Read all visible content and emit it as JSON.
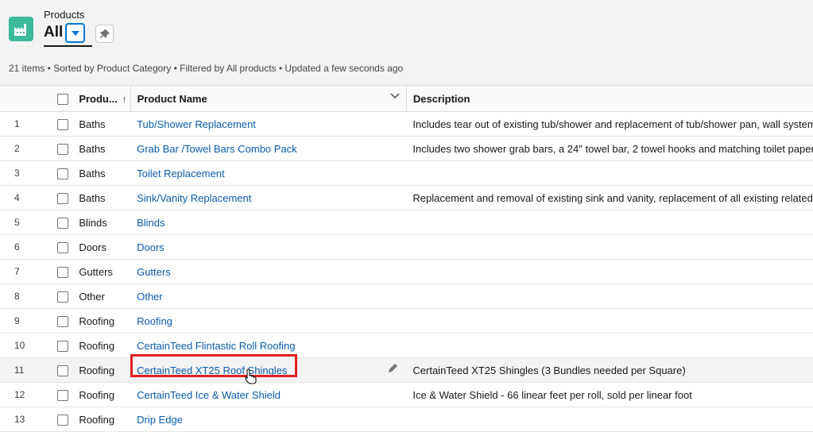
{
  "header": {
    "object_label": "Products",
    "view_name": "All",
    "summary": "21 items • Sorted by Product Category • Filtered by All products • Updated a few seconds ago",
    "icon_color": "#3bba9c"
  },
  "columns": {
    "category": "Produ...",
    "name": "Product Name",
    "description": "Description"
  },
  "rows": [
    {
      "num": "1",
      "category": "Baths",
      "name": "Tub/Shower Replacement",
      "description": "Includes tear out of existing tub/shower and replacement of tub/shower pan, wall system"
    },
    {
      "num": "2",
      "category": "Baths",
      "name": "Grab Bar /Towel Bars Combo Pack",
      "description": "Includes two shower grab bars, a 24\" towel bar, 2 towel hooks and matching toilet paper"
    },
    {
      "num": "3",
      "category": "Baths",
      "name": "Toilet Replacement",
      "description": ""
    },
    {
      "num": "4",
      "category": "Baths",
      "name": "Sink/Vanity Replacement",
      "description": "Replacement and removal of existing sink and vanity, replacement of all existing related"
    },
    {
      "num": "5",
      "category": "Blinds",
      "name": "Blinds",
      "description": ""
    },
    {
      "num": "6",
      "category": "Doors",
      "name": "Doors",
      "description": ""
    },
    {
      "num": "7",
      "category": "Gutters",
      "name": "Gutters",
      "description": ""
    },
    {
      "num": "8",
      "category": "Other",
      "name": "Other",
      "description": ""
    },
    {
      "num": "9",
      "category": "Roofing",
      "name": "Roofing",
      "description": ""
    },
    {
      "num": "10",
      "category": "Roofing",
      "name": "CertainTeed Flintastic Roll Roofing",
      "description": ""
    },
    {
      "num": "11",
      "category": "Roofing",
      "name": "CertainTeed XT25 Roof Shingles",
      "description": "CertainTeed XT25 Shingles (3 Bundles needed per Square)"
    },
    {
      "num": "12",
      "category": "Roofing",
      "name": "CertainTeed Ice & Water Shield",
      "description": "Ice & Water Shield - 66 linear feet per roll, sold per linear foot"
    },
    {
      "num": "13",
      "category": "Roofing",
      "name": "Drip Edge",
      "description": ""
    }
  ],
  "colors": {
    "link": "#0b5cab",
    "highlight": "#e0201f",
    "accent": "#0176d3"
  }
}
